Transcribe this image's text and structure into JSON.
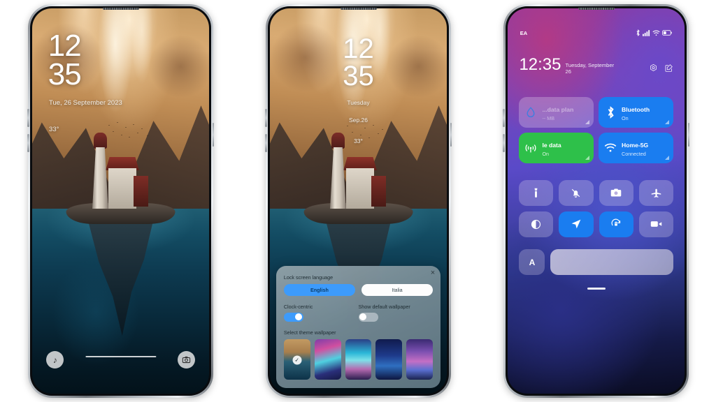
{
  "scene": {
    "background_color": "#ffffff",
    "phone_count": 3
  },
  "phone1": {
    "name": "lock-screen-default",
    "clock_hours": "12",
    "clock_minutes": "35",
    "date": "Tue, 26 September 2023",
    "temperature": "33°",
    "shortcut_left_icon": "music-note-icon",
    "shortcut_left_glyph": "♪",
    "shortcut_right_icon": "camera-icon",
    "home_indicator": true
  },
  "phone2": {
    "name": "lock-screen-clock-centric",
    "clock_hours": "12",
    "clock_minutes": "35",
    "day": "Tuesday",
    "date": "Sep.26",
    "temperature": "33°",
    "panel": {
      "close_label": "×",
      "language_label": "Lock screen language",
      "languages": [
        {
          "label": "English",
          "selected": true
        },
        {
          "label": "Italia",
          "selected": false
        }
      ],
      "toggles": [
        {
          "label": "Clock-centric",
          "on": true
        },
        {
          "label": "Show default wallpaper",
          "on": false
        }
      ],
      "wallpaper_label": "Select theme wallpaper",
      "wallpapers": [
        {
          "name": "lighthouse",
          "selected": true
        },
        {
          "name": "aurora-magenta",
          "selected": false
        },
        {
          "name": "aurora-cyan",
          "selected": false
        },
        {
          "name": "night-blue",
          "selected": false
        },
        {
          "name": "purple-peaks",
          "selected": false
        }
      ]
    }
  },
  "phone3": {
    "name": "control-center",
    "status": {
      "carrier": "EA",
      "icons": [
        "bluetooth-icon",
        "signal-icon",
        "wifi-icon",
        "battery-icon"
      ]
    },
    "time": "12:35",
    "date": "Tuesday, September 26",
    "actions": [
      "settings-gear-icon",
      "edit-icon"
    ],
    "tiles": [
      {
        "title": "...data plan",
        "subtitle": "-- MB",
        "icon": "data-drop-icon",
        "state": "dim"
      },
      {
        "title": "Bluetooth",
        "subtitle": "On",
        "icon": "bluetooth-icon",
        "state": "blue"
      },
      {
        "title": "le data",
        "subtitle": "On",
        "icon": "cell-signal-icon",
        "state": "green"
      },
      {
        "title": "Home-5G",
        "subtitle": "Connected",
        "icon": "wifi-icon",
        "state": "blue"
      }
    ],
    "quick_icons": [
      {
        "name": "flashlight-icon",
        "active": false
      },
      {
        "name": "mute-bell-icon",
        "active": false
      },
      {
        "name": "camera-icon",
        "active": false
      },
      {
        "name": "airplane-icon",
        "active": false
      },
      {
        "name": "contrast-icon",
        "active": false
      },
      {
        "name": "location-icon",
        "active": true
      },
      {
        "name": "rotation-lock-icon",
        "active": true
      },
      {
        "name": "screen-record-icon",
        "active": false
      }
    ],
    "auto_brightness_label": "A",
    "brightness_slider": true,
    "drag_handle": true
  }
}
